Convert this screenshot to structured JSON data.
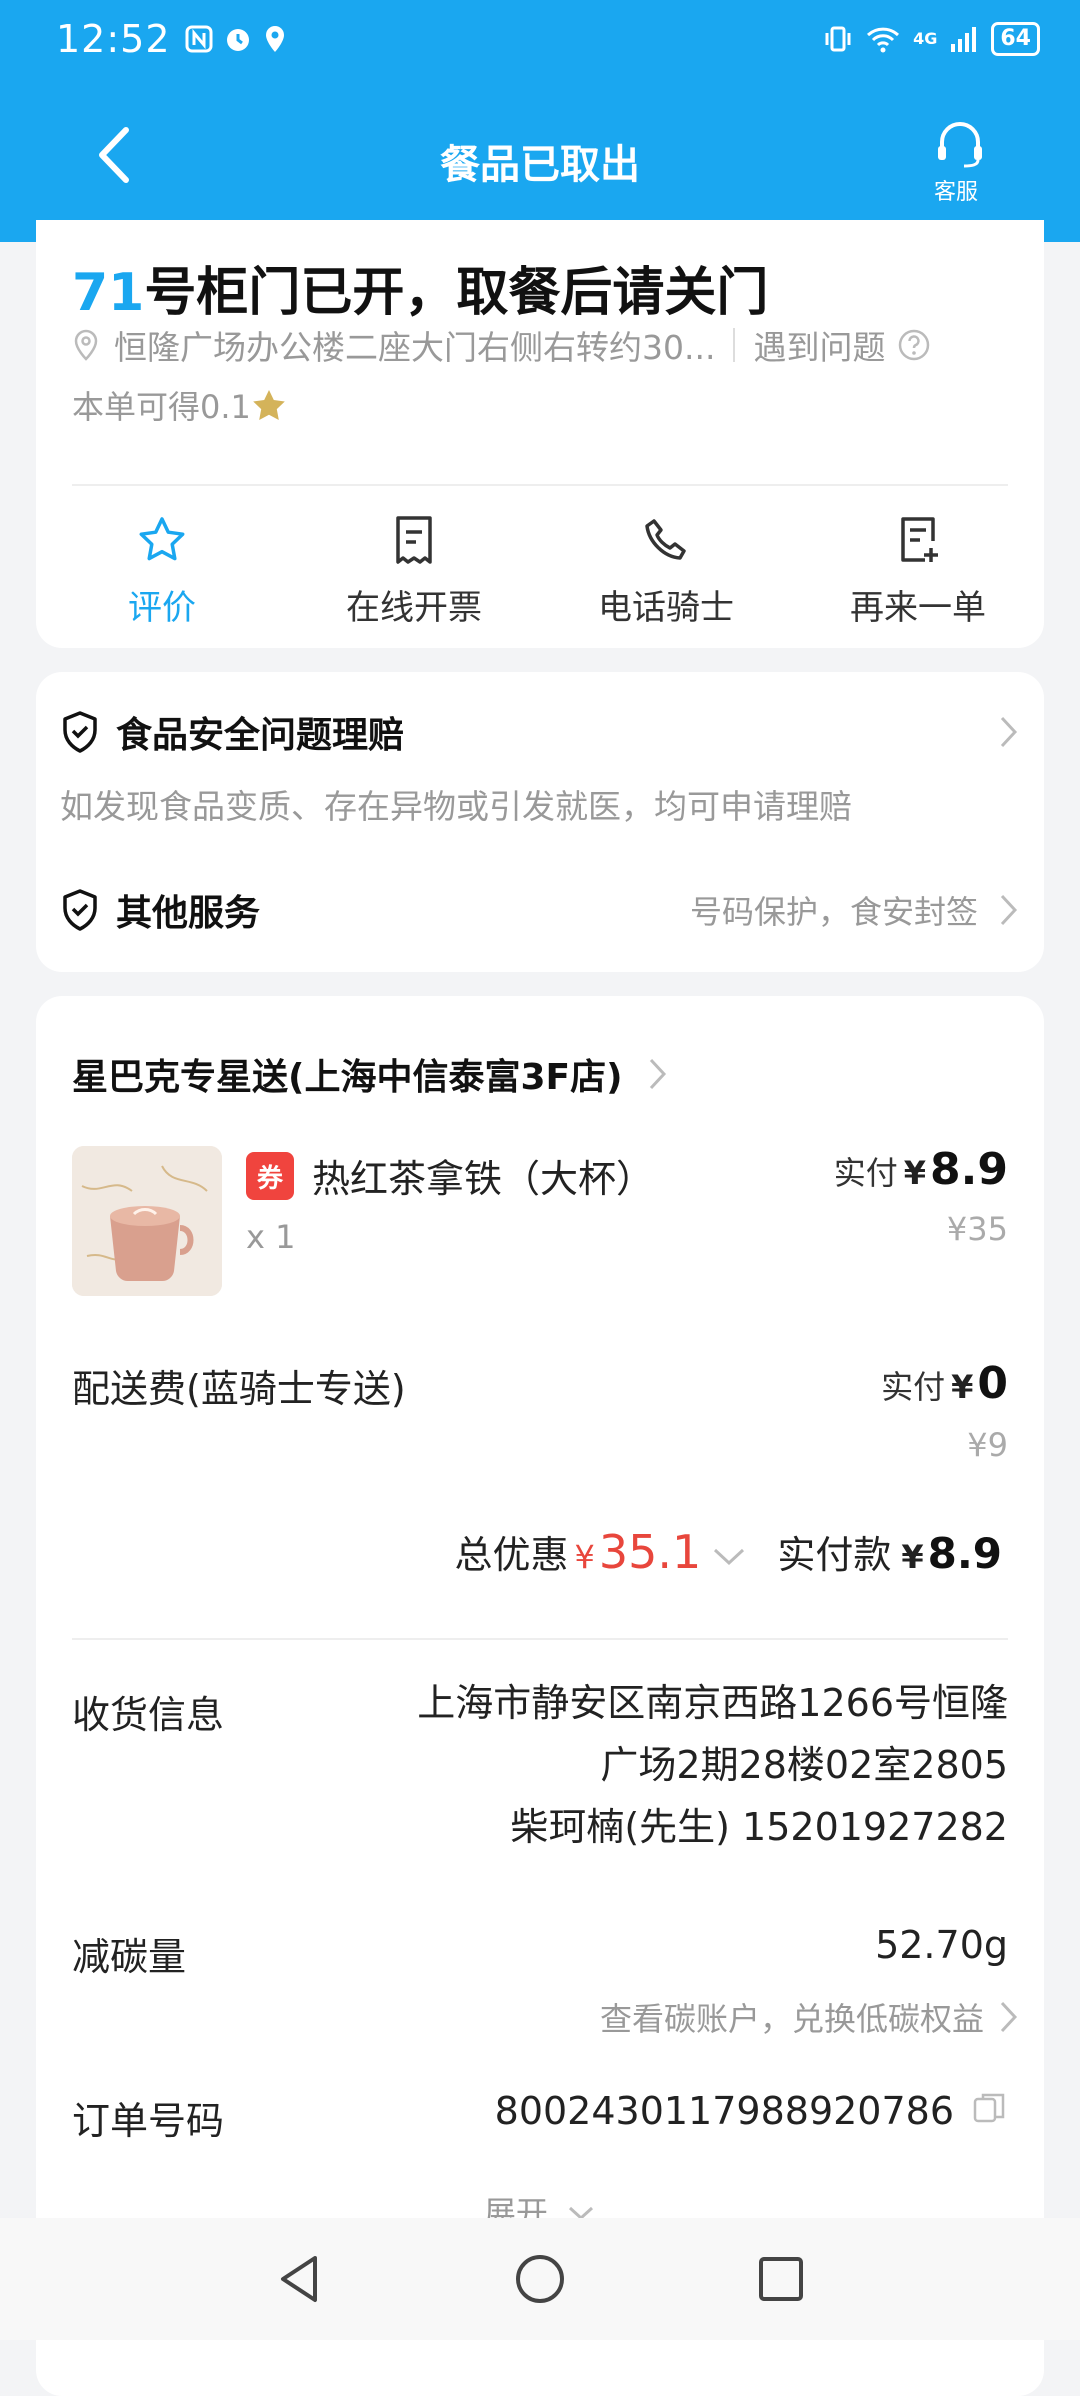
{
  "status_bar": {
    "time": "12:52",
    "network": "4G",
    "battery": "64"
  },
  "header": {
    "title": "餐品已取出",
    "service_label": "客服"
  },
  "pickup": {
    "locker_number": "71",
    "locker_message": "号柜门已开，取餐后请关门",
    "address": "恒隆广场办公楼二座大门右侧右转约30...",
    "problem_label": "遇到问题",
    "points_text": "本单可得0.1"
  },
  "actions": [
    {
      "label": "评价",
      "icon": "star-icon"
    },
    {
      "label": "在线开票",
      "icon": "receipt-icon"
    },
    {
      "label": "电话骑士",
      "icon": "phone-icon"
    },
    {
      "label": "再来一单",
      "icon": "reorder-icon"
    }
  ],
  "services": {
    "food_safety_title": "食品安全问题理赔",
    "food_safety_desc": "如发现食品变质、存在异物或引发就医，均可申请理赔",
    "other_title": "其他服务",
    "other_desc": "号码保护，食安封签"
  },
  "order": {
    "shop_name": "星巴克专星送(上海中信泰富3F店)",
    "coupon_badge": "券",
    "product_name": "热红茶拿铁（大杯）",
    "quantity": "x 1",
    "paid_label": "实付",
    "currency": "¥",
    "product_paid": "8.9",
    "product_original": "¥35",
    "delivery_label": "配送费(蓝骑士专送)",
    "delivery_paid": "0",
    "delivery_original": "¥9",
    "discount_label": "总优惠",
    "discount_value": "35.1",
    "total_label": "实付款",
    "total_value": "8.9",
    "receiver_label": "收货信息",
    "receiver_line1": "上海市静安区南京西路1266号恒隆",
    "receiver_line2": "广场2期28楼02室2805",
    "receiver_line3": "柴珂楠(先生) 15201927282",
    "carbon_label": "减碳量",
    "carbon_value": "52.70g",
    "carbon_link": "查看碳账户，兑换低碳权益",
    "order_no_label": "订单号码",
    "order_no": "8002430117988920786",
    "expand_label": "展开"
  },
  "colors": {
    "brand": "#1aa7f0",
    "discount": "#e8463c",
    "coupon": "#f0443e"
  }
}
